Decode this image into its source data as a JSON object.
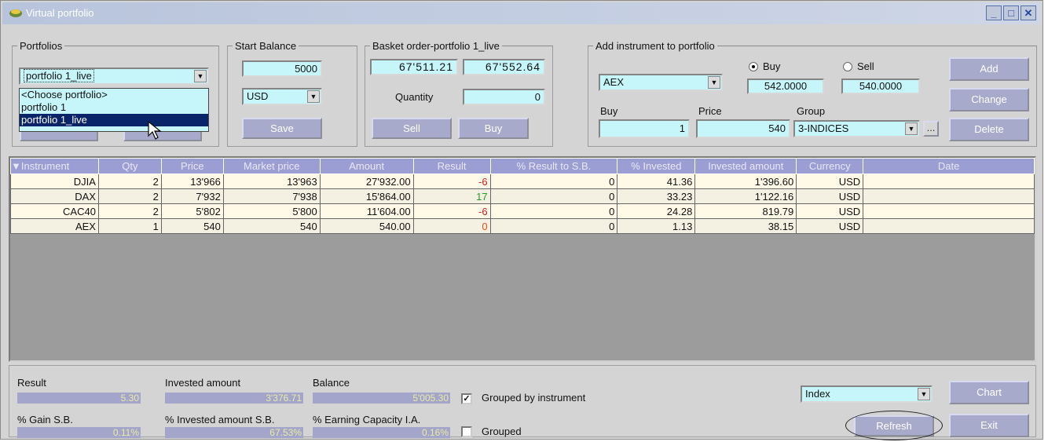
{
  "window": {
    "title": "Virtual portfolio"
  },
  "portfolios": {
    "legend": "Portfolios",
    "selected": "portfolio 1_live",
    "options": [
      "<Choose portfolio>",
      "portfolio 1",
      "portfolio 1_live"
    ]
  },
  "start_balance": {
    "legend": "Start Balance",
    "value": "5000",
    "currency": "USD",
    "save_label": "Save"
  },
  "basket": {
    "legend": "Basket order-portfolio 1_live",
    "sell_price": "67'511.21",
    "buy_price": "67'552.64",
    "quantity_label": "Quantity",
    "quantity": "0",
    "sell_label": "Sell",
    "buy_label": "Buy"
  },
  "add_instrument": {
    "legend": "Add instrument to portfolio",
    "instrument": "AEX",
    "buy_radio": "Buy",
    "sell_radio": "Sell",
    "buy_quote": "542.0000",
    "sell_quote": "540.0000",
    "buy_label": "Buy",
    "price_label": "Price",
    "group_label": "Group",
    "buy_qty": "1",
    "price": "540",
    "group": "3-INDICES",
    "ellipsis": "...",
    "add_label": "Add",
    "change_label": "Change",
    "delete_label": "Delete"
  },
  "grid": {
    "columns": [
      "Instrument",
      "Qty",
      "Price",
      "Market price",
      "Amount",
      "Result",
      "% Result to S.B.",
      "% Invested",
      "Invested amount",
      "Currency",
      "Date"
    ],
    "rows": [
      {
        "instrument": "DJIA",
        "qty": "2",
        "price": "13'966",
        "market": "13'963",
        "amount": "27'932.00",
        "result": "-6",
        "result_sb": "0",
        "invested": "41.36",
        "invested_amount": "1'396.60",
        "currency": "USD",
        "date": ""
      },
      {
        "instrument": "DAX",
        "qty": "2",
        "price": "7'932",
        "market": "7'938",
        "amount": "15'864.00",
        "result": "17",
        "result_sb": "0",
        "invested": "33.23",
        "invested_amount": "1'122.16",
        "currency": "USD",
        "date": ""
      },
      {
        "instrument": "CAC40",
        "qty": "2",
        "price": "5'802",
        "market": "5'800",
        "amount": "11'604.00",
        "result": "-6",
        "result_sb": "0",
        "invested": "24.28",
        "invested_amount": "819.79",
        "currency": "USD",
        "date": ""
      },
      {
        "instrument": "AEX",
        "qty": "1",
        "price": "540",
        "market": "540",
        "amount": "540.00",
        "result": "0",
        "result_sb": "0",
        "invested": "1.13",
        "invested_amount": "38.15",
        "currency": "USD",
        "date": ""
      }
    ]
  },
  "summary": {
    "result_label": "Result",
    "result": "5.30",
    "invested_label": "Invested amount",
    "invested": "3'376.71",
    "balance_label": "Balance",
    "balance": "5'005.30",
    "gain_label": "% Gain S.B.",
    "gain": "0.11%",
    "invested_sb_label": "% Invested amount S.B.",
    "invested_sb": "67.53%",
    "earning_label": "% Earning Capacity I.A.",
    "earning": "0.16%",
    "grouped_instrument_label": "Grouped by instrument",
    "grouped_label": "Grouped",
    "index_select": "Index",
    "chart_label": "Chart",
    "refresh_label": "Refresh",
    "exit_label": "Exit"
  }
}
